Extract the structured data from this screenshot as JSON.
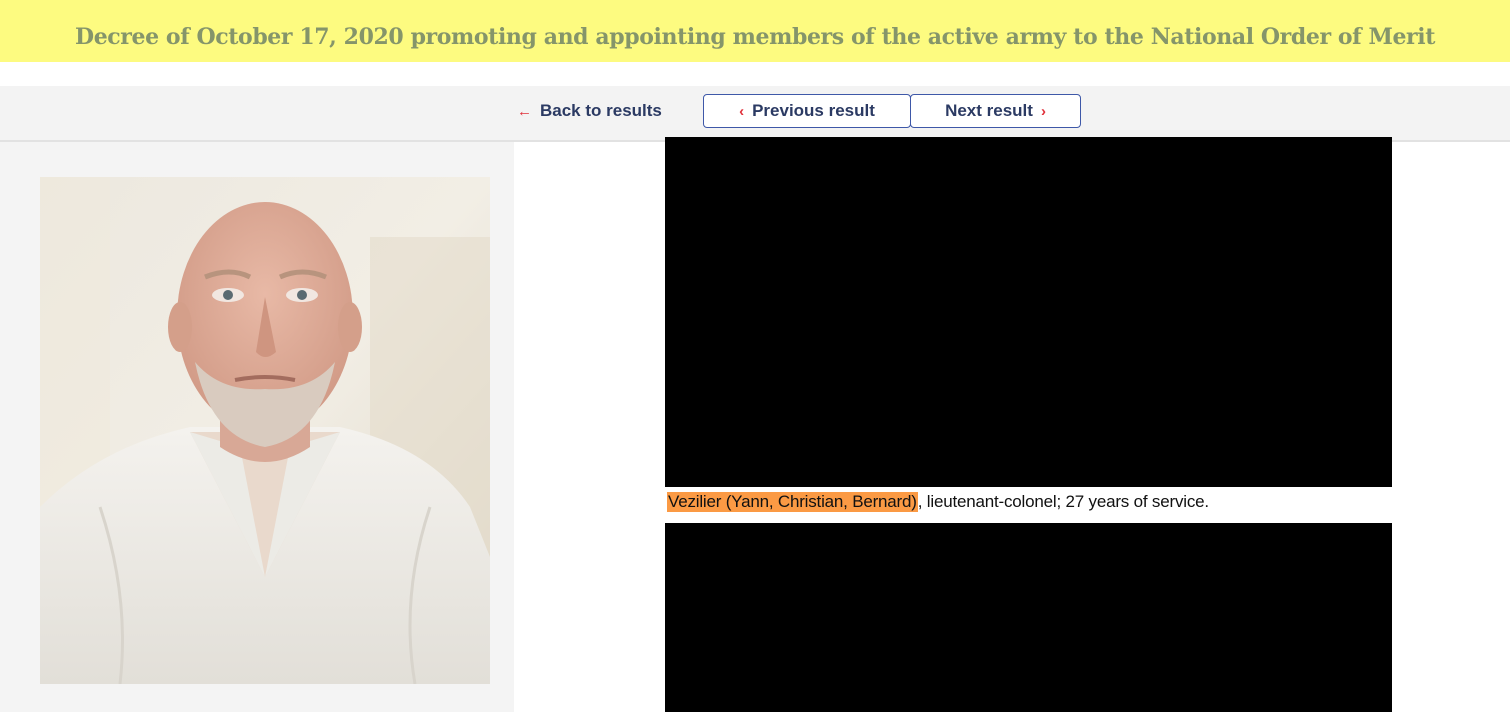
{
  "header": {
    "title": "Decree of October 17, 2020 promoting and appointing members of the active army to the National Order of Merit",
    "background_color": "#fdfb80",
    "title_color": "#85956a"
  },
  "navigation": {
    "back_arrow_icon": "left-arrow-icon",
    "back_label": "Back to results",
    "previous_chevron": "‹",
    "previous_label": "Previous result",
    "next_label": "Next result",
    "next_chevron": "›",
    "accent_color": "#e0303a",
    "text_color": "#2b3a63"
  },
  "record": {
    "highlighted_name": "Vezilier (Yann, Christian, Bernard)",
    "details": ", lieutenant-colonel; 27 years of service.",
    "highlight_color": "#fb9a44"
  },
  "photo": {
    "subject": "portrait-photo"
  }
}
